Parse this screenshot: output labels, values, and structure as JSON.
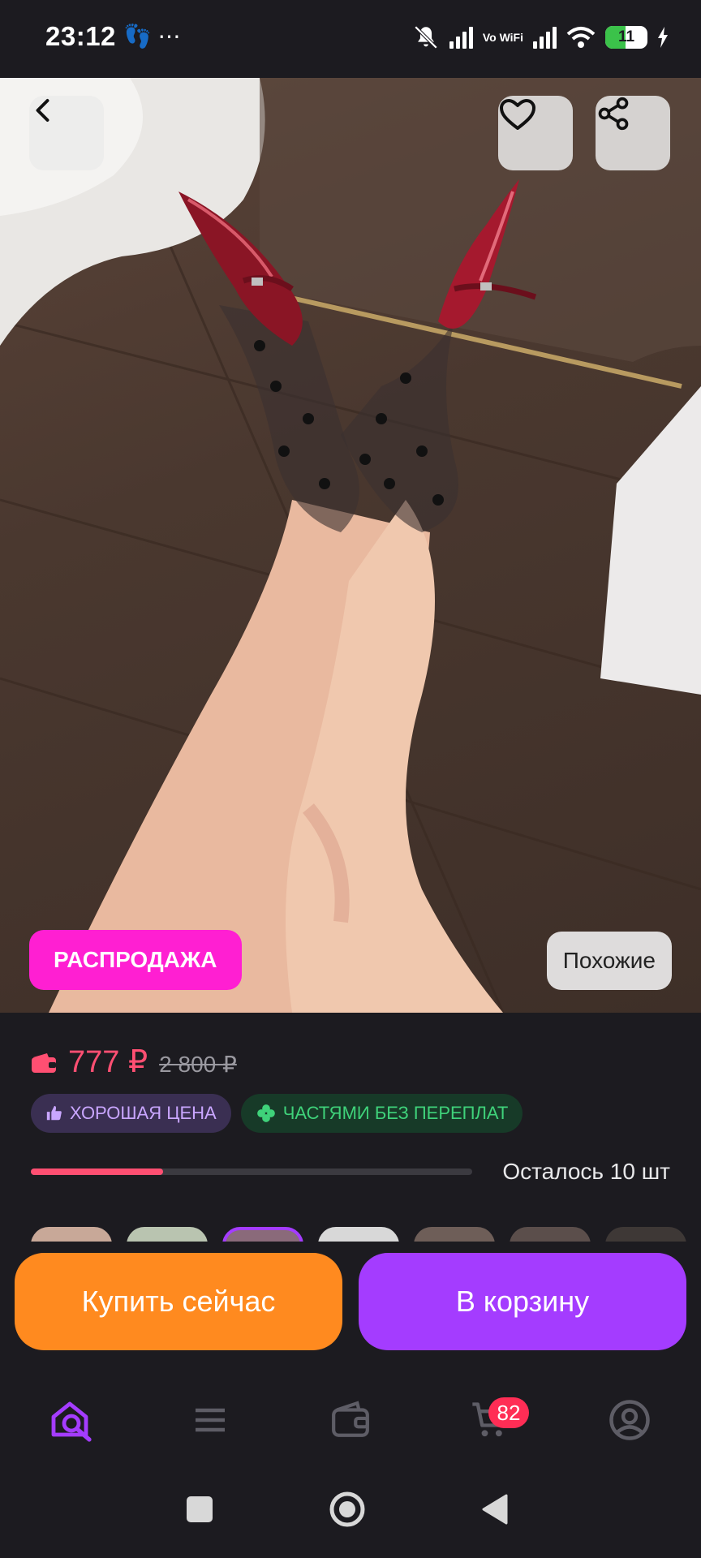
{
  "status": {
    "time": "23:12",
    "left_icons": "⋯",
    "network": "Vo WiFi",
    "battery": "11",
    "battery_level": 0.11
  },
  "hero": {
    "sale_badge": "РАСПРОДАЖА",
    "similar_label": "Похожие",
    "icons": {
      "back": "chevron-left-icon",
      "favorite": "heart-icon",
      "share": "share-icon"
    }
  },
  "product": {
    "price": "777 ₽",
    "old_price": "2 800 ₽",
    "chip_good_price": "ХОРОШАЯ ЦЕНА",
    "chip_installments": "ЧАСТЯМИ БЕЗ ПЕРЕПЛАТ",
    "stock_text": "Осталось 10 шт",
    "stock_fraction": 0.3
  },
  "actions": {
    "buy_now": "Купить сейчас",
    "add_to_cart": "В корзину"
  },
  "nav": {
    "cart_count": "82",
    "items": [
      "home-search-icon",
      "catalog-menu-icon",
      "wallet-icon",
      "cart-icon",
      "profile-icon"
    ]
  },
  "colors": {
    "accent_purple": "#a43cff",
    "accent_orange": "#ff8a1f",
    "price_red": "#ff4f72",
    "sale_pink": "#ff1fd2"
  }
}
